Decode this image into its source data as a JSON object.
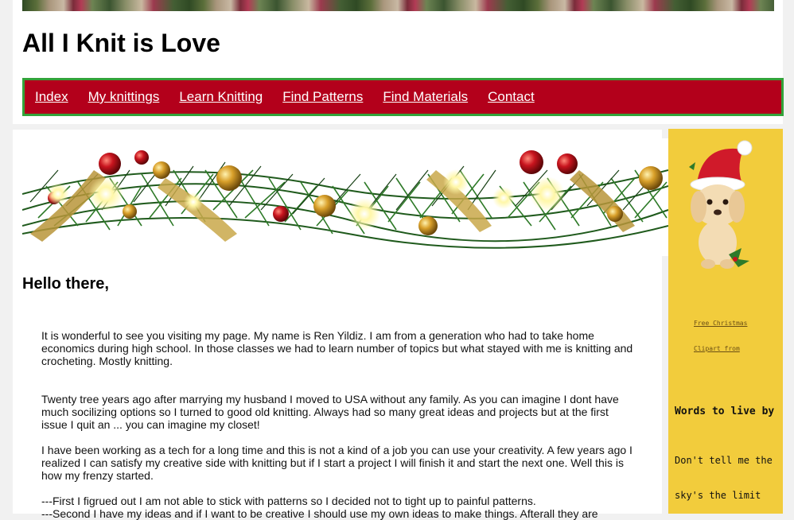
{
  "header": {
    "title": "All I Knit is Love"
  },
  "nav": {
    "items": [
      {
        "label": "Index"
      },
      {
        "label": "My knittings"
      },
      {
        "label": "Learn Knitting"
      },
      {
        "label": "Find Patterns"
      },
      {
        "label": "Find Materials"
      },
      {
        "label": "Contact"
      }
    ]
  },
  "main": {
    "greeting": "Hello there,",
    "paragraphs": [
      "It is wonderful to see you visiting my page. My name is Ren Yildiz. I am from a generation who had to take home economics during high school. In those classes we had to learn number of topics but what stayed with me is knitting and crocheting. Mostly knitting.",
      "Twenty tree years ago after marrying my husband I moved to USA without any family. As you can imagine I dont have much socilizing options so I turned to good old knitting. Always had so many great ideas and projects but at the first issue I quit an ... you can imagine my closet!",
      "I have been working as a tech for a long time and this is not a kind of a job you can use your creativity. A few years ago I realized I can satisfy my creative side with knitting but if I start a project I will finish it and start the next one. Well this is how my frenzy started.",
      "---First I figrued out I am not able to stick with patterns so I decided not to tight up to painful patterns.",
      "---Second I have my ideas and if I want to be creative I should use my own ideas to make things. Afterall they are"
    ]
  },
  "sidebar": {
    "credit_line1": "Free Christmas",
    "credit_line2": "Clipart from",
    "words_title": "Words to live by",
    "quote_line1": "Don't tell me the",
    "quote_line2": "sky's the limit"
  },
  "colors": {
    "nav_bg": "#b3001b",
    "nav_border": "#33a33a",
    "sidebar_bg": "#f2cc3c"
  },
  "icons": [
    "christmas-garland-image",
    "santa-hat-puppy-image",
    "knitting-banner-image"
  ]
}
